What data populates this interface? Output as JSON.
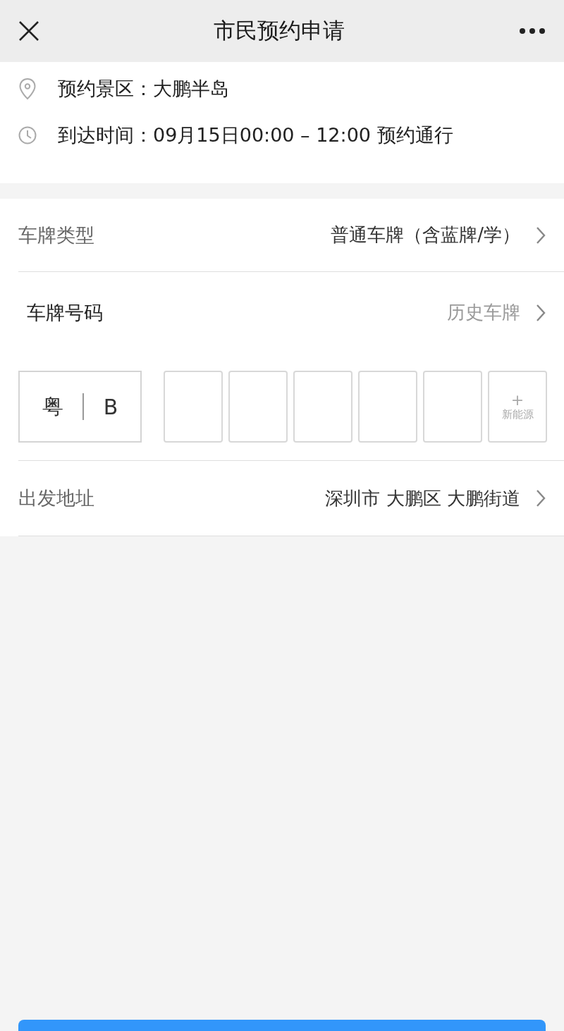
{
  "header": {
    "title": "市民预约申请"
  },
  "info": [
    {
      "kind": "location",
      "label": "预约景区：",
      "value": "大鹏半岛"
    },
    {
      "kind": "time",
      "label": "到达时间：",
      "value": "09月15日00:00 – 12:00 预约通行"
    }
  ],
  "plate_type": {
    "label": "车牌类型",
    "value": "普通车牌（含蓝牌/学）"
  },
  "plate_number": {
    "label": "车牌号码",
    "link": "历史车牌"
  },
  "plate": {
    "province": "粤",
    "letter": "B",
    "slots": [
      {
        "kind": "empty"
      },
      {
        "kind": "empty"
      },
      {
        "kind": "empty"
      },
      {
        "kind": "empty"
      },
      {
        "kind": "empty"
      },
      {
        "kind": "new_energy",
        "symbol": "+",
        "label": "新能源"
      }
    ]
  },
  "departure": {
    "label": "出发地址",
    "value": "深圳市 大鹏区 大鹏街道"
  }
}
